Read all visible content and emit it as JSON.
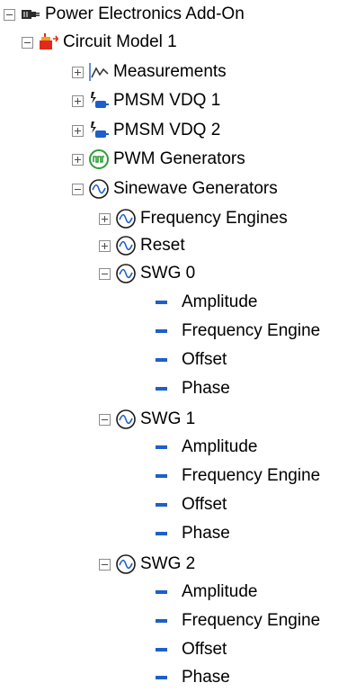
{
  "tree": {
    "root": {
      "label": "Power Electronics Add-On",
      "icon": "plugin-icon",
      "expanded": true
    },
    "model": {
      "label": "Circuit Model 1",
      "icon": "circuit-model-icon",
      "expanded": true
    },
    "measurements": {
      "label": "Measurements",
      "icon": "waveform-icon",
      "expanded": false
    },
    "pmsm1": {
      "label": "PMSM VDQ 1",
      "icon": "motor-icon",
      "expanded": false
    },
    "pmsm2": {
      "label": "PMSM VDQ 2",
      "icon": "motor-icon",
      "expanded": false
    },
    "pwm": {
      "label": "PWM Generators",
      "icon": "pwm-icon",
      "expanded": false
    },
    "sinewave": {
      "label": "Sinewave Generators",
      "icon": "sine-icon",
      "expanded": true
    },
    "freq_engines": {
      "label": "Frequency Engines",
      "icon": "sine-icon",
      "expanded": false
    },
    "reset": {
      "label": "Reset",
      "icon": "sine-icon",
      "expanded": false
    },
    "swg": [
      {
        "label": "SWG 0",
        "expanded": true,
        "children": [
          "Amplitude",
          "Frequency Engine",
          "Offset",
          "Phase"
        ]
      },
      {
        "label": "SWG 1",
        "expanded": true,
        "children": [
          "Amplitude",
          "Frequency Engine",
          "Offset",
          "Phase"
        ]
      },
      {
        "label": "SWG 2",
        "expanded": true,
        "children": [
          "Amplitude",
          "Frequency Engine",
          "Offset",
          "Phase"
        ]
      }
    ]
  },
  "colors": {
    "accent_blue": "#1f5fc9",
    "pwm_green": "#2e9e3a",
    "model_red": "#e02a1e",
    "model_orange": "#f2a21b"
  }
}
